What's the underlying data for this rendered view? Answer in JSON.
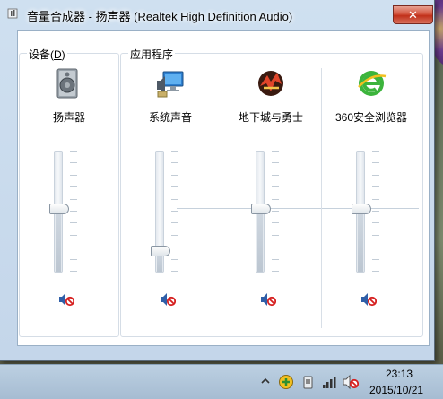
{
  "window": {
    "title": "音量合成器 - 扬声器 (Realtek High Definition Audio)",
    "close_glyph": "✕"
  },
  "device_group": {
    "label_prefix": "设备(",
    "label_accel": "D",
    "label_suffix": ")",
    "channel": {
      "name": "扬声器",
      "icon": "speaker-icon",
      "level_percent": 52,
      "muted": true
    }
  },
  "apps_group": {
    "label": "应用程序",
    "channels": [
      {
        "name": "系统声音",
        "icon": "system-sounds-icon",
        "level_percent": 17,
        "muted": true
      },
      {
        "name": "地下城与勇士",
        "icon": "dnf-game-icon",
        "level_percent": 52,
        "muted": true
      },
      {
        "name": "360安全浏览器",
        "icon": "360-browser-icon",
        "level_percent": 52,
        "muted": true
      }
    ]
  },
  "taskbar": {
    "tray_icons": [
      "show-hidden-icons-arrow",
      "360-security-icon",
      "usb-device-icon",
      "network-signal-icon",
      "volume-muted-icon"
    ],
    "time": "23:13",
    "date": "2015/10/21"
  },
  "colors": {
    "accent": "#3a7bd5",
    "mute_red": "#d62020"
  }
}
